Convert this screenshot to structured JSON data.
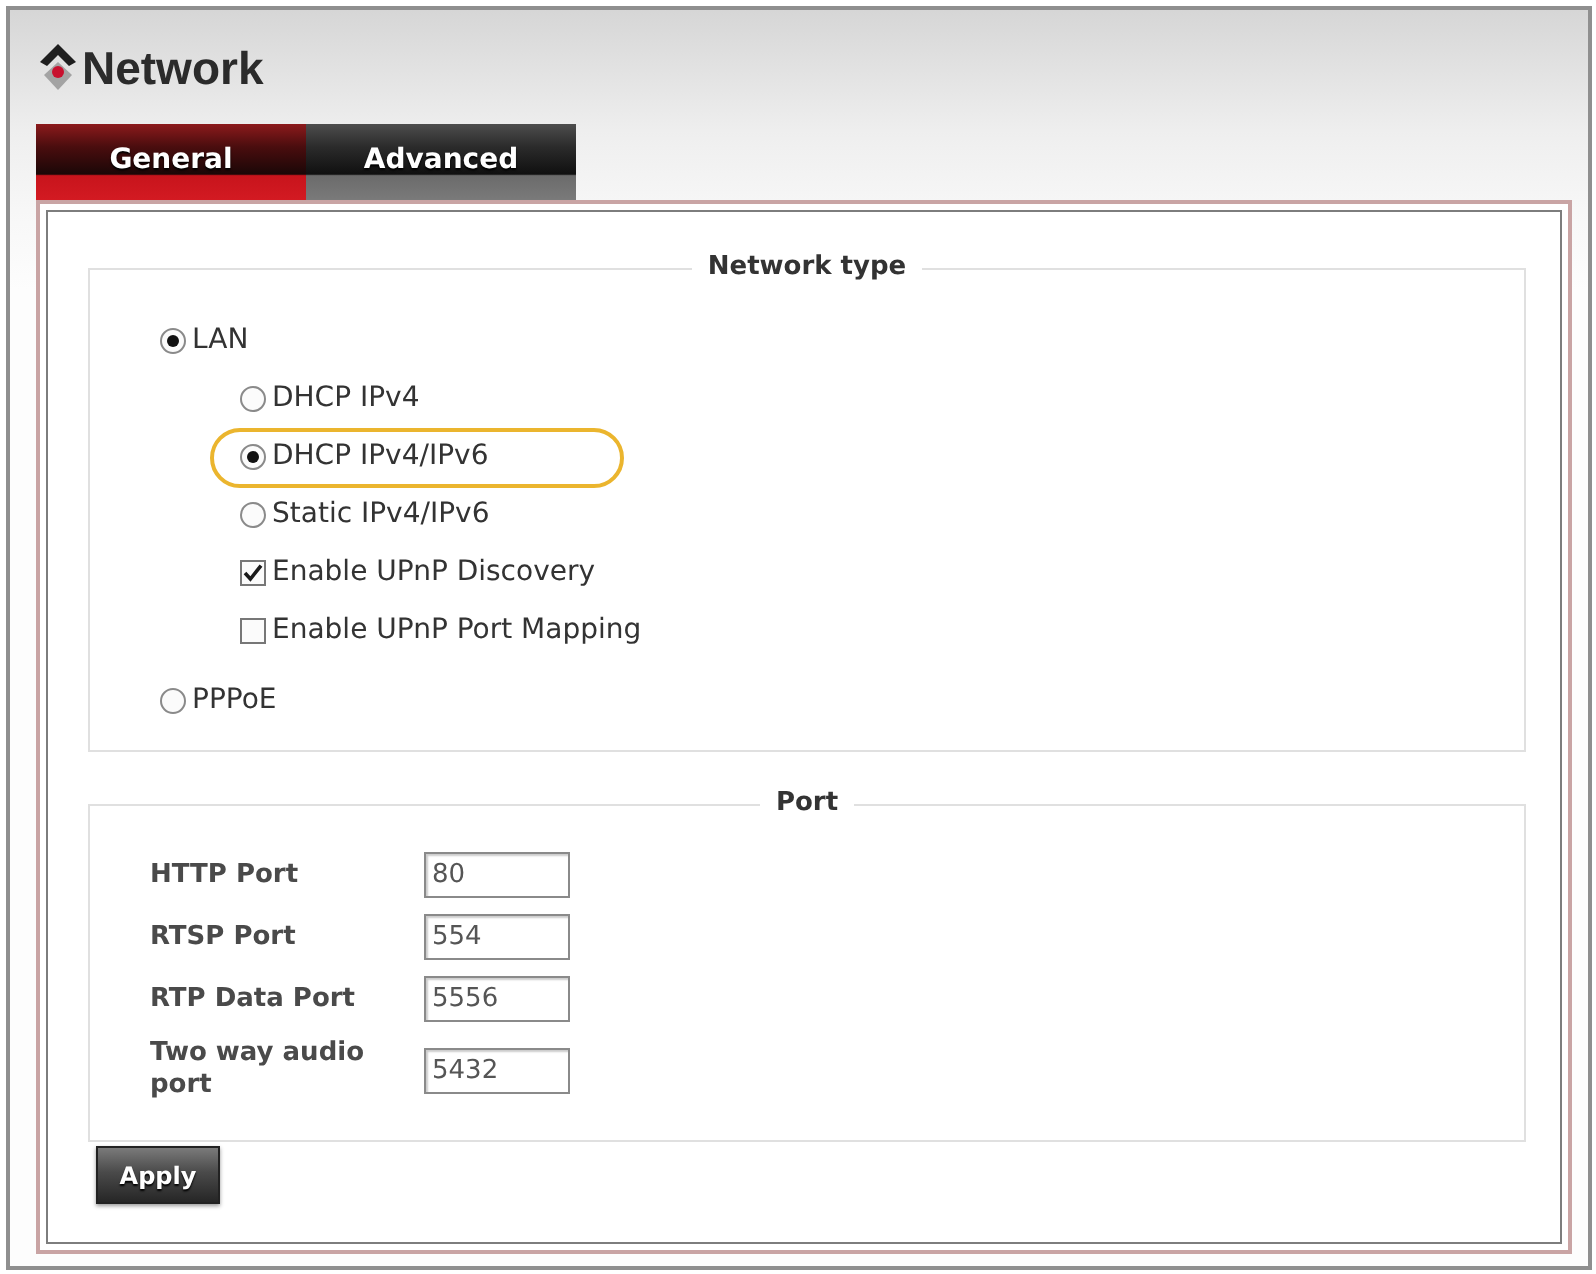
{
  "window": {
    "title": "Network"
  },
  "tabs": [
    {
      "label": "General",
      "selected": true
    },
    {
      "label": "Advanced",
      "selected": false
    }
  ],
  "network_type": {
    "legend": "Network type",
    "options": [
      {
        "kind": "radio",
        "label": "LAN",
        "selected": true,
        "highlighted": false,
        "children": [
          {
            "kind": "radio",
            "label": "DHCP IPv4",
            "selected": false,
            "highlighted": false
          },
          {
            "kind": "radio",
            "label": "DHCP IPv4/IPv6",
            "selected": true,
            "highlighted": true
          },
          {
            "kind": "radio",
            "label": "Static IPv4/IPv6",
            "selected": false,
            "highlighted": false
          },
          {
            "kind": "checkbox",
            "label": "Enable UPnP Discovery",
            "checked": true,
            "highlighted": false
          },
          {
            "kind": "checkbox",
            "label": "Enable UPnP Port Mapping",
            "checked": false,
            "highlighted": false
          }
        ]
      },
      {
        "kind": "radio",
        "label": "PPPoE",
        "selected": false,
        "highlighted": false
      }
    ]
  },
  "port": {
    "legend": "Port",
    "fields": [
      {
        "label": "HTTP Port",
        "value": "80"
      },
      {
        "label": "RTSP Port",
        "value": "554"
      },
      {
        "label": "RTP Data Port",
        "value": "5556"
      },
      {
        "label": "Two way audio port",
        "value": "5432"
      }
    ]
  },
  "buttons": [
    {
      "label": "Apply"
    }
  ]
}
